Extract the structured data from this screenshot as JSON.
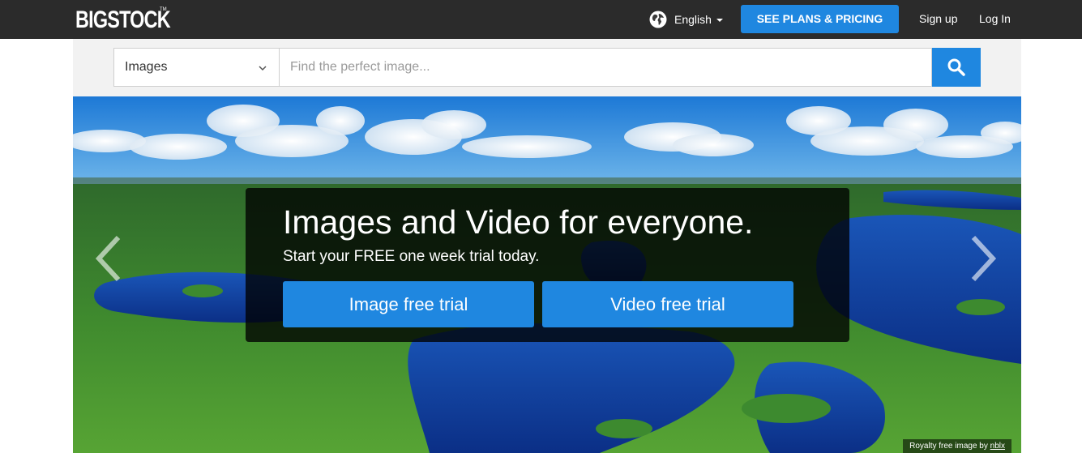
{
  "header": {
    "logo_text": "BIGSTOCK",
    "logo_tm": "TM",
    "language_label": "English",
    "plans_button": "SEE PLANS & PRICING",
    "signup_link": "Sign up",
    "login_link": "Log In"
  },
  "search": {
    "type_selected": "Images",
    "placeholder": "Find the perfect image...",
    "icons": {
      "type_dropdown": "chevron-down-icon",
      "submit": "search-icon",
      "language": "globe-icon"
    }
  },
  "hero": {
    "headline": "Images and Video for everyone.",
    "subheadline": "Start your FREE one week trial today.",
    "image_trial_button": "Image free trial",
    "video_trial_button": "Video free trial",
    "credit_prefix": "Royalty free image by",
    "credit_author": "nblx",
    "icons": {
      "prev": "chevron-left-icon",
      "next": "chevron-right-icon"
    }
  },
  "colors": {
    "topbar": "#2b2b2b",
    "accent_blue": "#1f87e0",
    "search_strip": "#f2f2f2",
    "overlay": "rgba(0,0,0,0.78)"
  }
}
